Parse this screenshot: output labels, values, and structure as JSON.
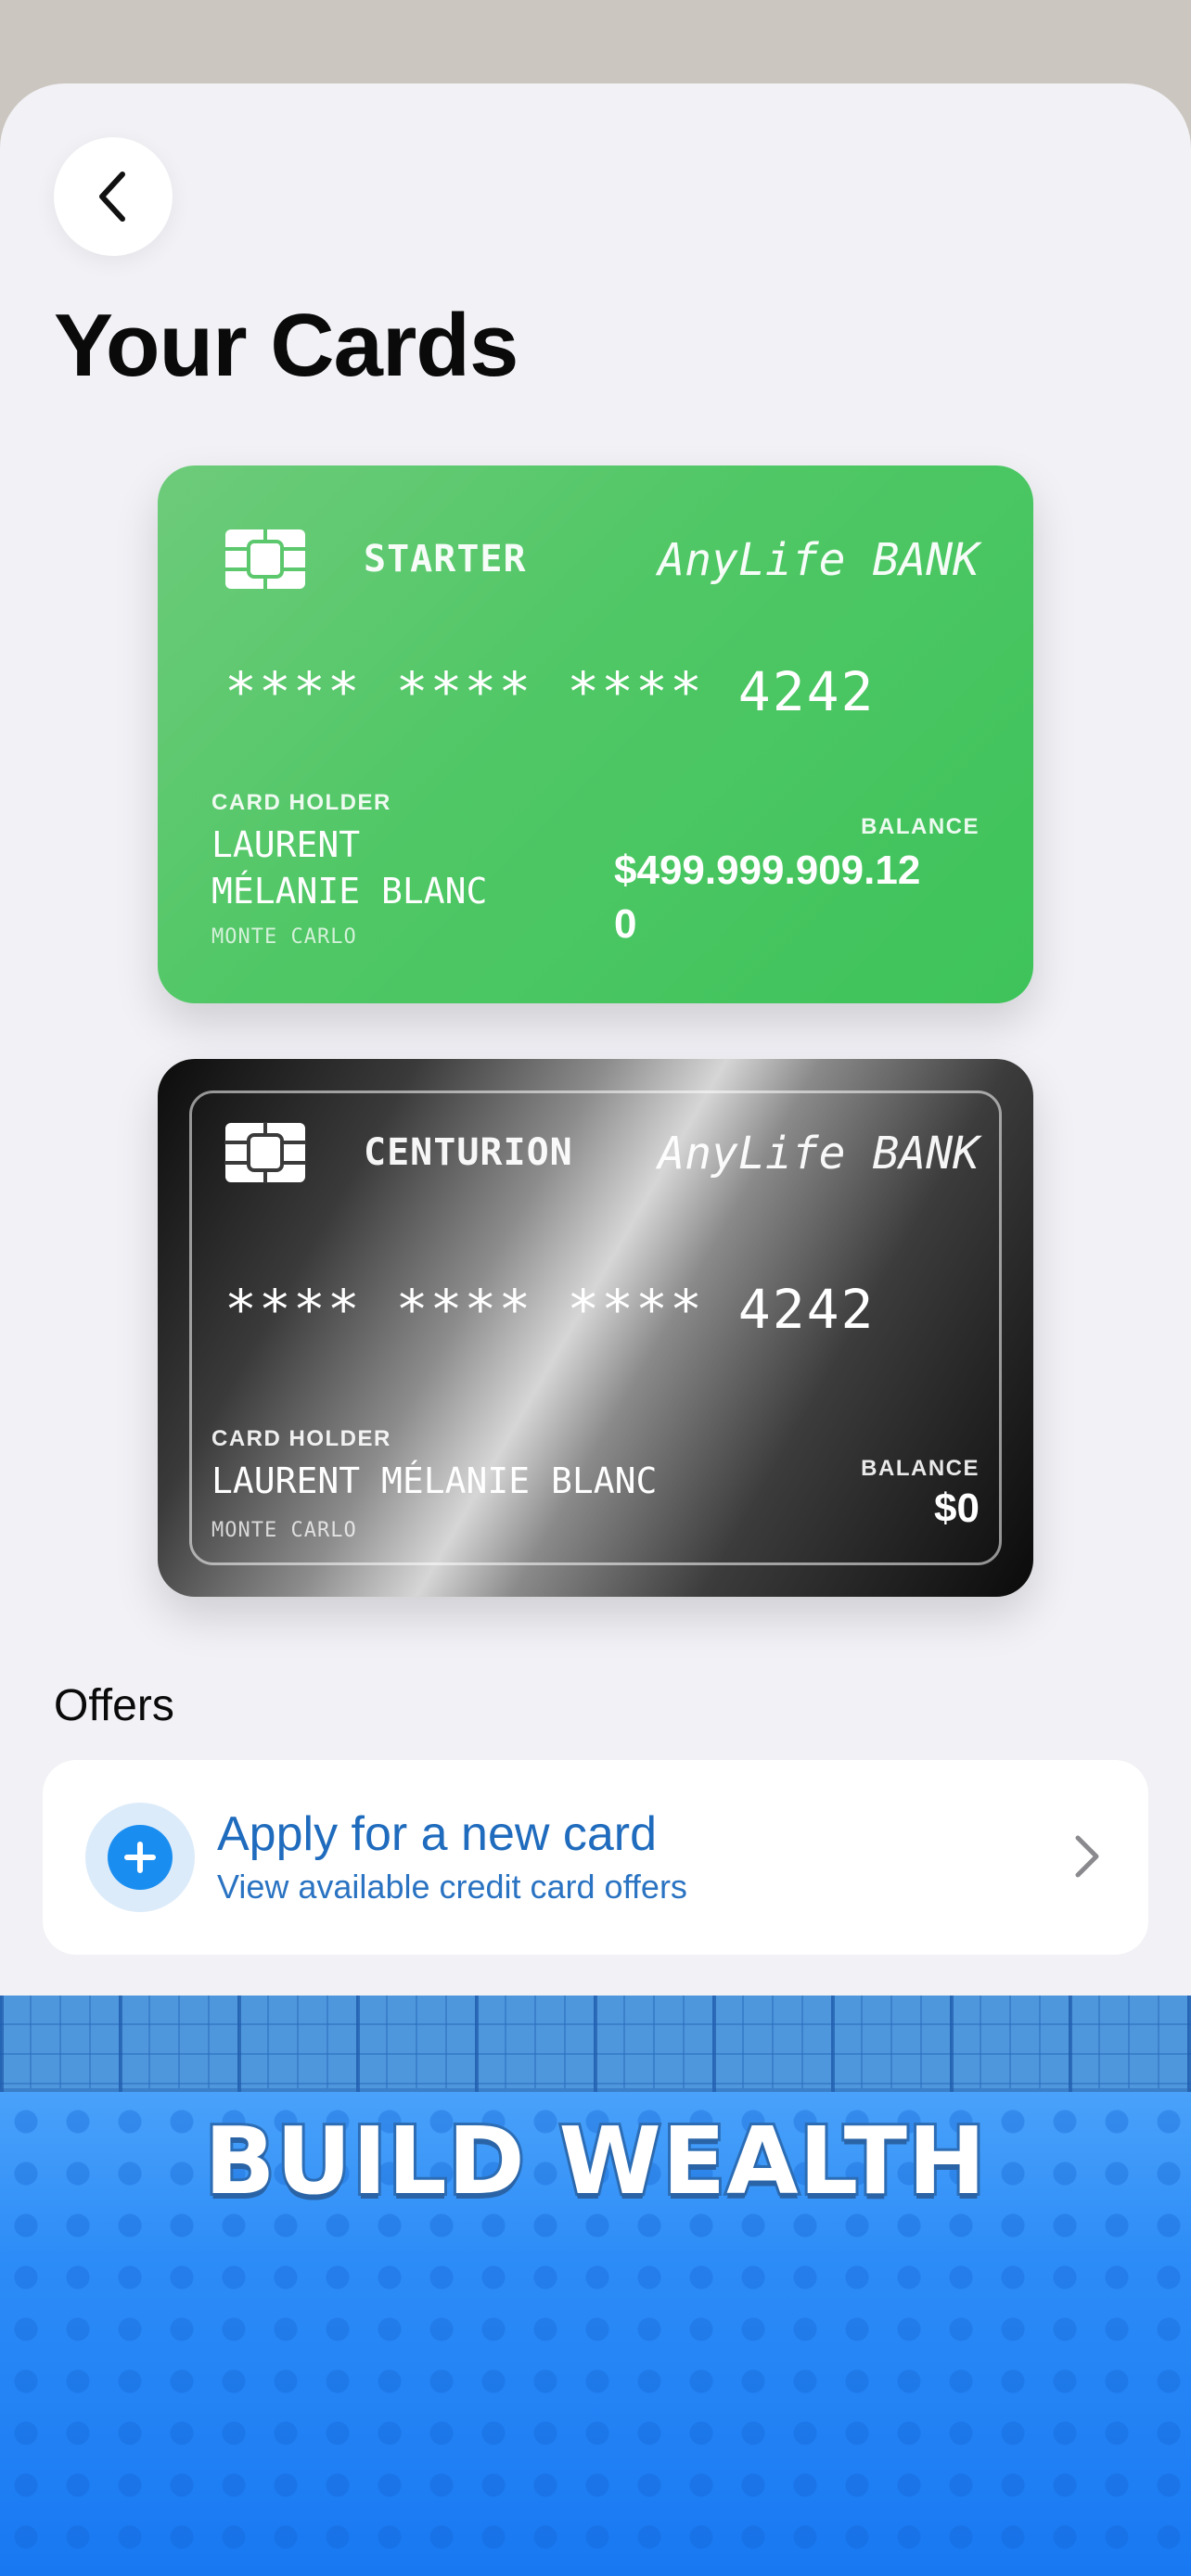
{
  "header": {
    "title": "Your Cards"
  },
  "cards": [
    {
      "tier": "STARTER",
      "bank": "AnyLife BANK",
      "number": "**** **** **** 4242",
      "holder_label": "CARD HOLDER",
      "holder_line1": "LAURENT",
      "holder_line2": "MÉLANIE BLANC",
      "city": "MONTE CARLO",
      "balance_label": "BALANCE",
      "balance_line1": "$499.999.909.12",
      "balance_line2": "0",
      "color": "#4fc765"
    },
    {
      "tier": "CENTURION",
      "bank": "AnyLife BANK",
      "number": "**** **** **** 4242",
      "holder_label": "CARD HOLDER",
      "holder_name": "LAURENT MÉLANIE BLANC",
      "city": "MONTE CARLO",
      "balance_label": "BALANCE",
      "balance": "$0",
      "color": "#0c0c0c"
    }
  ],
  "offers": {
    "title": "Offers",
    "items": [
      {
        "title": "Apply for a new card",
        "subtitle": "View available credit card offers",
        "icon": "plus-icon",
        "accent": "#1a8ef0"
      }
    ]
  },
  "banner": {
    "text": "BUILD WEALTH"
  }
}
